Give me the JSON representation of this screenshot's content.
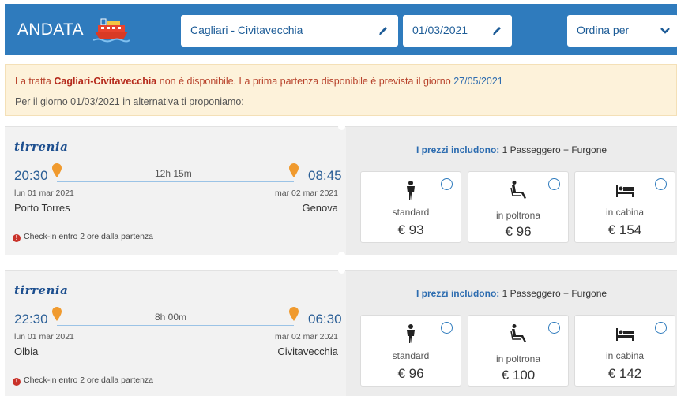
{
  "header": {
    "title": "ANDATA",
    "route_value": "Cagliari - Civitavecchia",
    "date_value": "01/03/2021",
    "sort_label": "Ordina per"
  },
  "alert": {
    "prefix": "La tratta ",
    "route": "Cagliari-Civitavecchia",
    "middle": " non è disponibile. La prima partenza disponibile è prevista il giorno ",
    "first_date": "27/05/2021",
    "line2": "Per il giorno 01/03/2021 in alternativa ti proponiamo:"
  },
  "results": [
    {
      "operator": "tirrenia",
      "dep_time": "20:30",
      "arr_time": "08:45",
      "duration": "12h 15m",
      "dep_date": "lun 01 mar 2021",
      "arr_date": "mar 02 mar 2021",
      "dep_port": "Porto Torres",
      "arr_port": "Genova",
      "checkin": "Check-in entro 2 ore dalla partenza",
      "includes_label": "I prezzi includono:",
      "includes_value": " 1 Passeggero + Furgone",
      "options": [
        {
          "name": "standard",
          "price": "€ 93",
          "icon": "person-icon"
        },
        {
          "name": "in poltrona",
          "price": "€ 96",
          "icon": "seat-icon"
        },
        {
          "name": "in cabina",
          "price": "€ 154",
          "icon": "bed-icon"
        }
      ]
    },
    {
      "operator": "tirrenia",
      "dep_time": "22:30",
      "arr_time": "06:30",
      "duration": "8h 00m",
      "dep_date": "lun 01 mar 2021",
      "arr_date": "mar 02 mar 2021",
      "dep_port": "Olbia",
      "arr_port": "Civitavecchia",
      "checkin": "Check-in entro 2 ore dalla partenza",
      "includes_label": "I prezzi includono:",
      "includes_value": " 1 Passeggero + Furgone",
      "options": [
        {
          "name": "standard",
          "price": "€ 96",
          "icon": "person-icon"
        },
        {
          "name": "in poltrona",
          "price": "€ 100",
          "icon": "seat-icon"
        },
        {
          "name": "in cabina",
          "price": "€ 142",
          "icon": "bed-icon"
        }
      ]
    }
  ],
  "colors": {
    "header_bg": "#2f7bbd",
    "alert_bg": "#fdf2da",
    "accent_text": "#2a5e96",
    "pin": "#f09a2e"
  }
}
